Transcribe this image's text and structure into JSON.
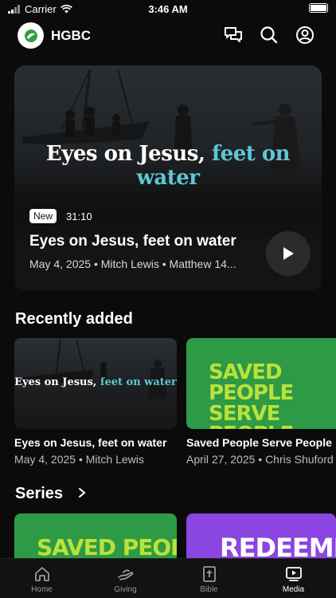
{
  "status_bar": {
    "carrier": "Carrier",
    "time": "3:46 AM"
  },
  "header": {
    "title": "HGBC"
  },
  "hero": {
    "art_title_main": "Eyes on Jesus,",
    "art_title_accent": " feet on water",
    "badge": "New",
    "duration": "31:10",
    "title": "Eyes on Jesus, feet on water",
    "meta": "May 4, 2025 • Mitch Lewis • Matthew 14..."
  },
  "recently_added": {
    "heading": "Recently added",
    "items": [
      {
        "art_main": "Eyes on Jesus,",
        "art_accent": " feet on water",
        "title": "Eyes on Jesus, feet on water",
        "meta": "May 4, 2025 • Mitch Lewis"
      },
      {
        "art_line1": "SAVED PEOPLE",
        "art_line2": "SERVE PEOPLE",
        "title": "Saved People Serve People",
        "meta": "April 27, 2025 • Chris Shuford"
      }
    ]
  },
  "series": {
    "heading": "Series",
    "items": [
      {
        "art": "SAVED PEOPLE"
      },
      {
        "art": "REDEEMED"
      }
    ]
  },
  "tabs": [
    {
      "label": "Home",
      "icon": "home-icon"
    },
    {
      "label": "Giving",
      "icon": "giving-icon"
    },
    {
      "label": "Bible",
      "icon": "bible-icon"
    },
    {
      "label": "Media",
      "icon": "media-icon"
    }
  ],
  "colors": {
    "accent": "#5ec7d2",
    "green": "#2f9a45",
    "lime": "#b9e23a",
    "purple": "#8b45e0"
  }
}
